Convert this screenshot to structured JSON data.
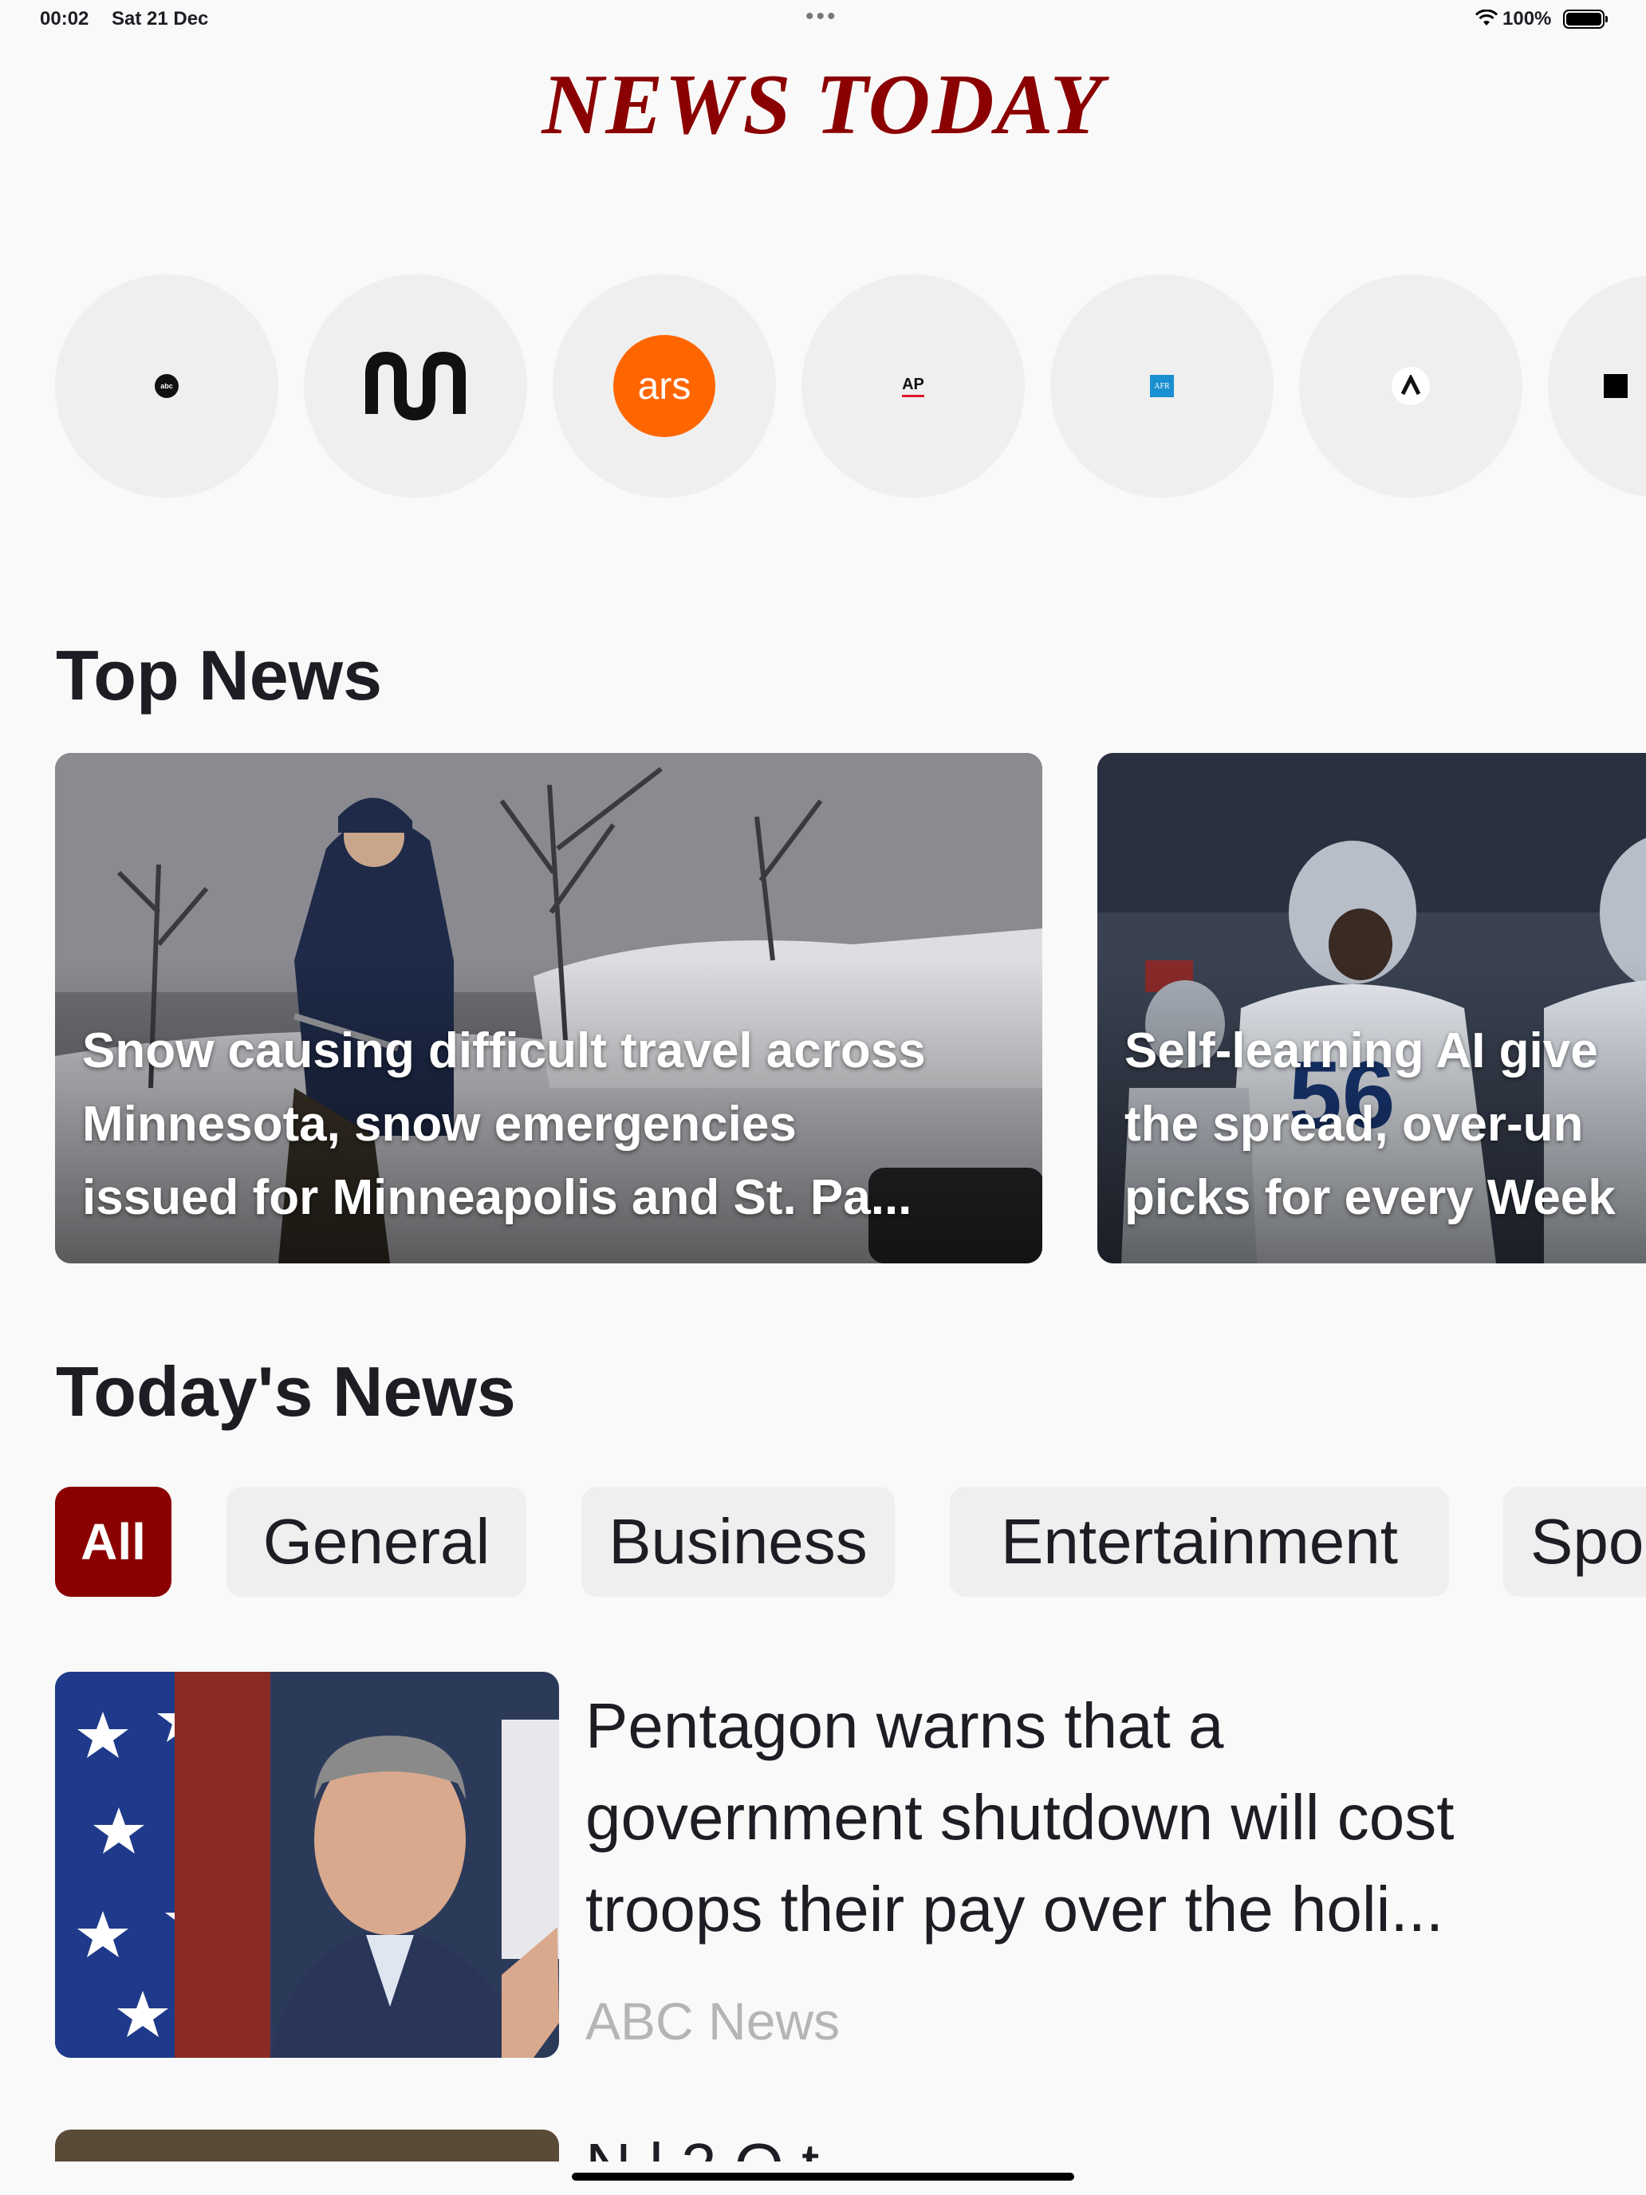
{
  "status_bar": {
    "time": "00:02",
    "date": "Sat 21 Dec",
    "dots": "•••",
    "battery": "100%"
  },
  "app": {
    "title": "NEWS TODAY"
  },
  "sources": [
    {
      "name": "abc",
      "icon": "abc-news-logo"
    },
    {
      "name": "ABC",
      "icon": "abc-australia-logo"
    },
    {
      "name": "ars",
      "icon": "ars-technica-logo"
    },
    {
      "name": "AP",
      "icon": "associated-press-logo"
    },
    {
      "name": "AFR",
      "icon": "afr-logo"
    },
    {
      "name": "A",
      "icon": "axios-logo"
    },
    {
      "name": "",
      "icon": "square-logo"
    }
  ],
  "top_news": {
    "heading": "Top News",
    "items": [
      {
        "headline": "Snow causing difficult travel across\nMinnesota, snow emergencies\nissued for Minneapolis and St. Pa..."
      },
      {
        "headline": "Self-learning AI give\nthe spread, over-un\npicks for every Week"
      }
    ]
  },
  "todays_news": {
    "heading": "Today's News",
    "categories": [
      "All",
      "General",
      "Business",
      "Entertainment",
      "Spo"
    ],
    "articles": [
      {
        "title": "Pentagon warns that a\ngovernment shutdown will cost\ntroops their pay over the holi...",
        "source": "ABC News"
      },
      {
        "title": "N     l           2          O       t"
      }
    ]
  },
  "colors": {
    "brand": "#8b0000",
    "chip_bg": "#efefef",
    "source_text": "#b5b5b5",
    "background": "#f9f9f9"
  }
}
